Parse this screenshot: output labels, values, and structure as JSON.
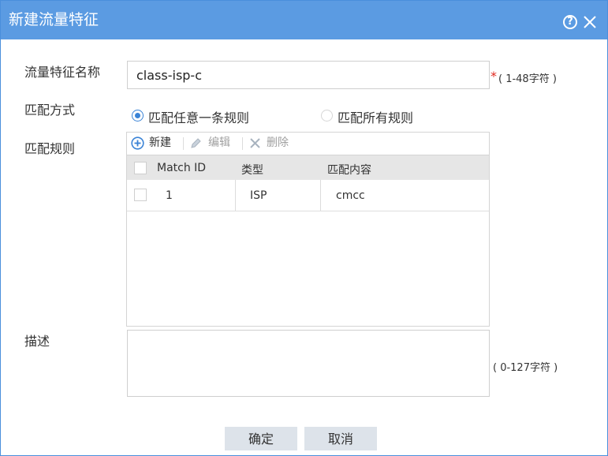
{
  "dialog": {
    "title": "新建流量特征"
  },
  "form": {
    "name_label": "流量特征名称",
    "name_value": "class-isp-c",
    "required_mark": "*",
    "name_hint": "( 1-48字符 )",
    "match_mode_label": "匹配方式",
    "match_mode_options": [
      {
        "label": "匹配任意一条规则",
        "selected": true
      },
      {
        "label": "匹配所有规则",
        "selected": false
      }
    ],
    "rules_label": "匹配规则",
    "description_label": "描述",
    "description_value": "",
    "description_hint": "( 0-127字符 )"
  },
  "rules_toolbar": {
    "new_label": "新建",
    "edit_label": "编辑",
    "delete_label": "删除"
  },
  "rules_table": {
    "columns": [
      "Match ID",
      "类型",
      "匹配内容"
    ],
    "rows": [
      {
        "match_id": "1",
        "type": "ISP",
        "content": "cmcc"
      }
    ]
  },
  "buttons": {
    "ok": "确定",
    "cancel": "取消"
  },
  "colors": {
    "titlebar": "#5b9be2",
    "accent": "#3a83d6",
    "required": "#e0291f",
    "button_bg": "#dde3ea"
  },
  "icons": [
    "help-icon",
    "close-icon",
    "add-icon",
    "edit-icon",
    "delete-icon"
  ]
}
